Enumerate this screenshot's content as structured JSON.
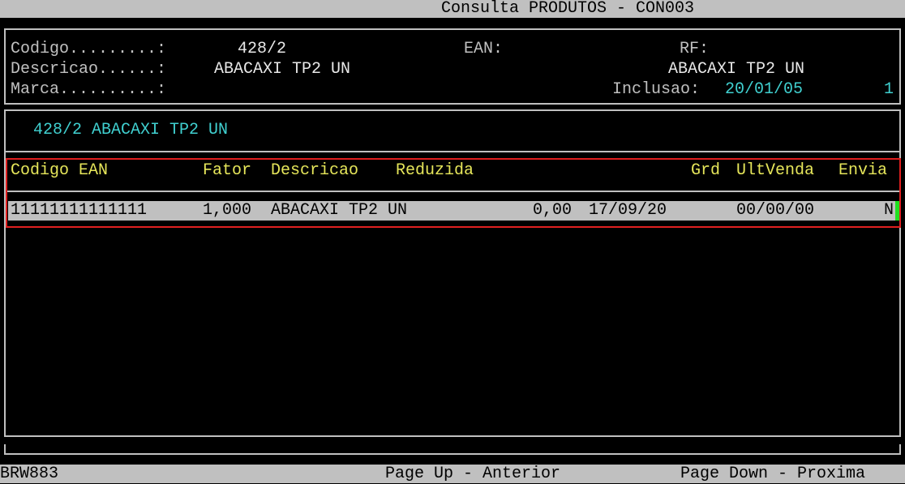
{
  "title_bar": {
    "title": "Consulta PRODUTOS - CON003"
  },
  "header": {
    "codigo_label": "Codigo.........:",
    "codigo_value": "428/2",
    "ean_label": "EAN:",
    "rf_label": "RF:",
    "descricao_label": "Descricao......:",
    "descricao_value": "ABACAXI TP2 UN",
    "descricao_right": "ABACAXI TP2 UN",
    "marca_label": "Marca..........:",
    "inclusao_label": "Inclusao:",
    "inclusao_value": "20/01/05",
    "page_value": "1"
  },
  "product_line": "428/2 ABACAXI TP2 UN",
  "table": {
    "columns": {
      "codigo_ean": "Codigo EAN",
      "fator": "Fator",
      "descricao": "Descricao",
      "reduzida": "Reduzida",
      "grd": "Grd",
      "ultvenda": "UltVenda",
      "envia": "Envia"
    },
    "rows": [
      {
        "codigo_ean": "11111111111111",
        "fator": "1,000",
        "descricao": "ABACAXI TP2 UN",
        "value": "0,00",
        "date": "17/09/20",
        "ultvenda": "00/00/00",
        "envia": "N"
      }
    ]
  },
  "status_bar": {
    "program": "BRW883",
    "page_up": "Page Up - Anterior",
    "page_down": "Page Down - Proxima"
  },
  "colors": {
    "background": "#000000",
    "bar": "#c0c0c0",
    "label": "#c0c0c0",
    "value": "#e8e8e8",
    "cyan": "#40d0d0",
    "header": "#e6e65a",
    "highlight": "#e02020",
    "cursor": "#20e020"
  }
}
